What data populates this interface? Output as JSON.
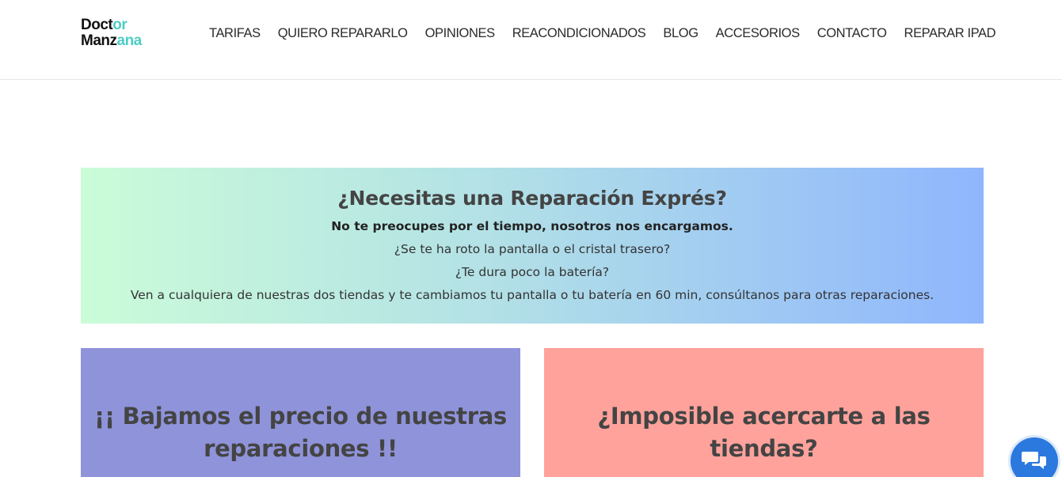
{
  "header": {
    "logo": {
      "line1": "Doct",
      "line1_accent": "or",
      "line2": "Manz",
      "line2_accent": "ana"
    },
    "nav": [
      "TARIFAS",
      "QUIERO REPARARLO",
      "OPINIONES",
      "REACONDICIONADOS",
      "BLOG",
      "ACCESORIOS",
      "CONTACTO",
      "REPARAR IPAD"
    ]
  },
  "promo": {
    "title": "¿Necesitas una Reparación Exprés?",
    "subtitle": "No te preocupes por el tiempo, nosotros nos encargamos.",
    "line1": "¿Se te ha roto la pantalla o el cristal trasero?",
    "line2": "¿Te dura poco la batería?",
    "line3": "Ven a  cualquiera de nuestras dos tiendas y te cambiamos tu pantalla o tu batería en 60 min, consúltanos para otras reparaciones."
  },
  "cards": {
    "left": {
      "title": "¡¡ Bajamos el precio de nuestras reparaciones !!"
    },
    "right": {
      "title": "¿Imposible acercarte a las tiendas?"
    }
  },
  "chat": {
    "icon": "chat-bubbles-icon"
  },
  "colors": {
    "promo_gradient_start": "#cbfcd8",
    "promo_gradient_end": "#8fb6fd",
    "card_left_bg": "#8f93da",
    "card_right_bg": "#ffa29b",
    "logo_accent": "#4ecdc4",
    "chat_button": "#2b78df"
  }
}
